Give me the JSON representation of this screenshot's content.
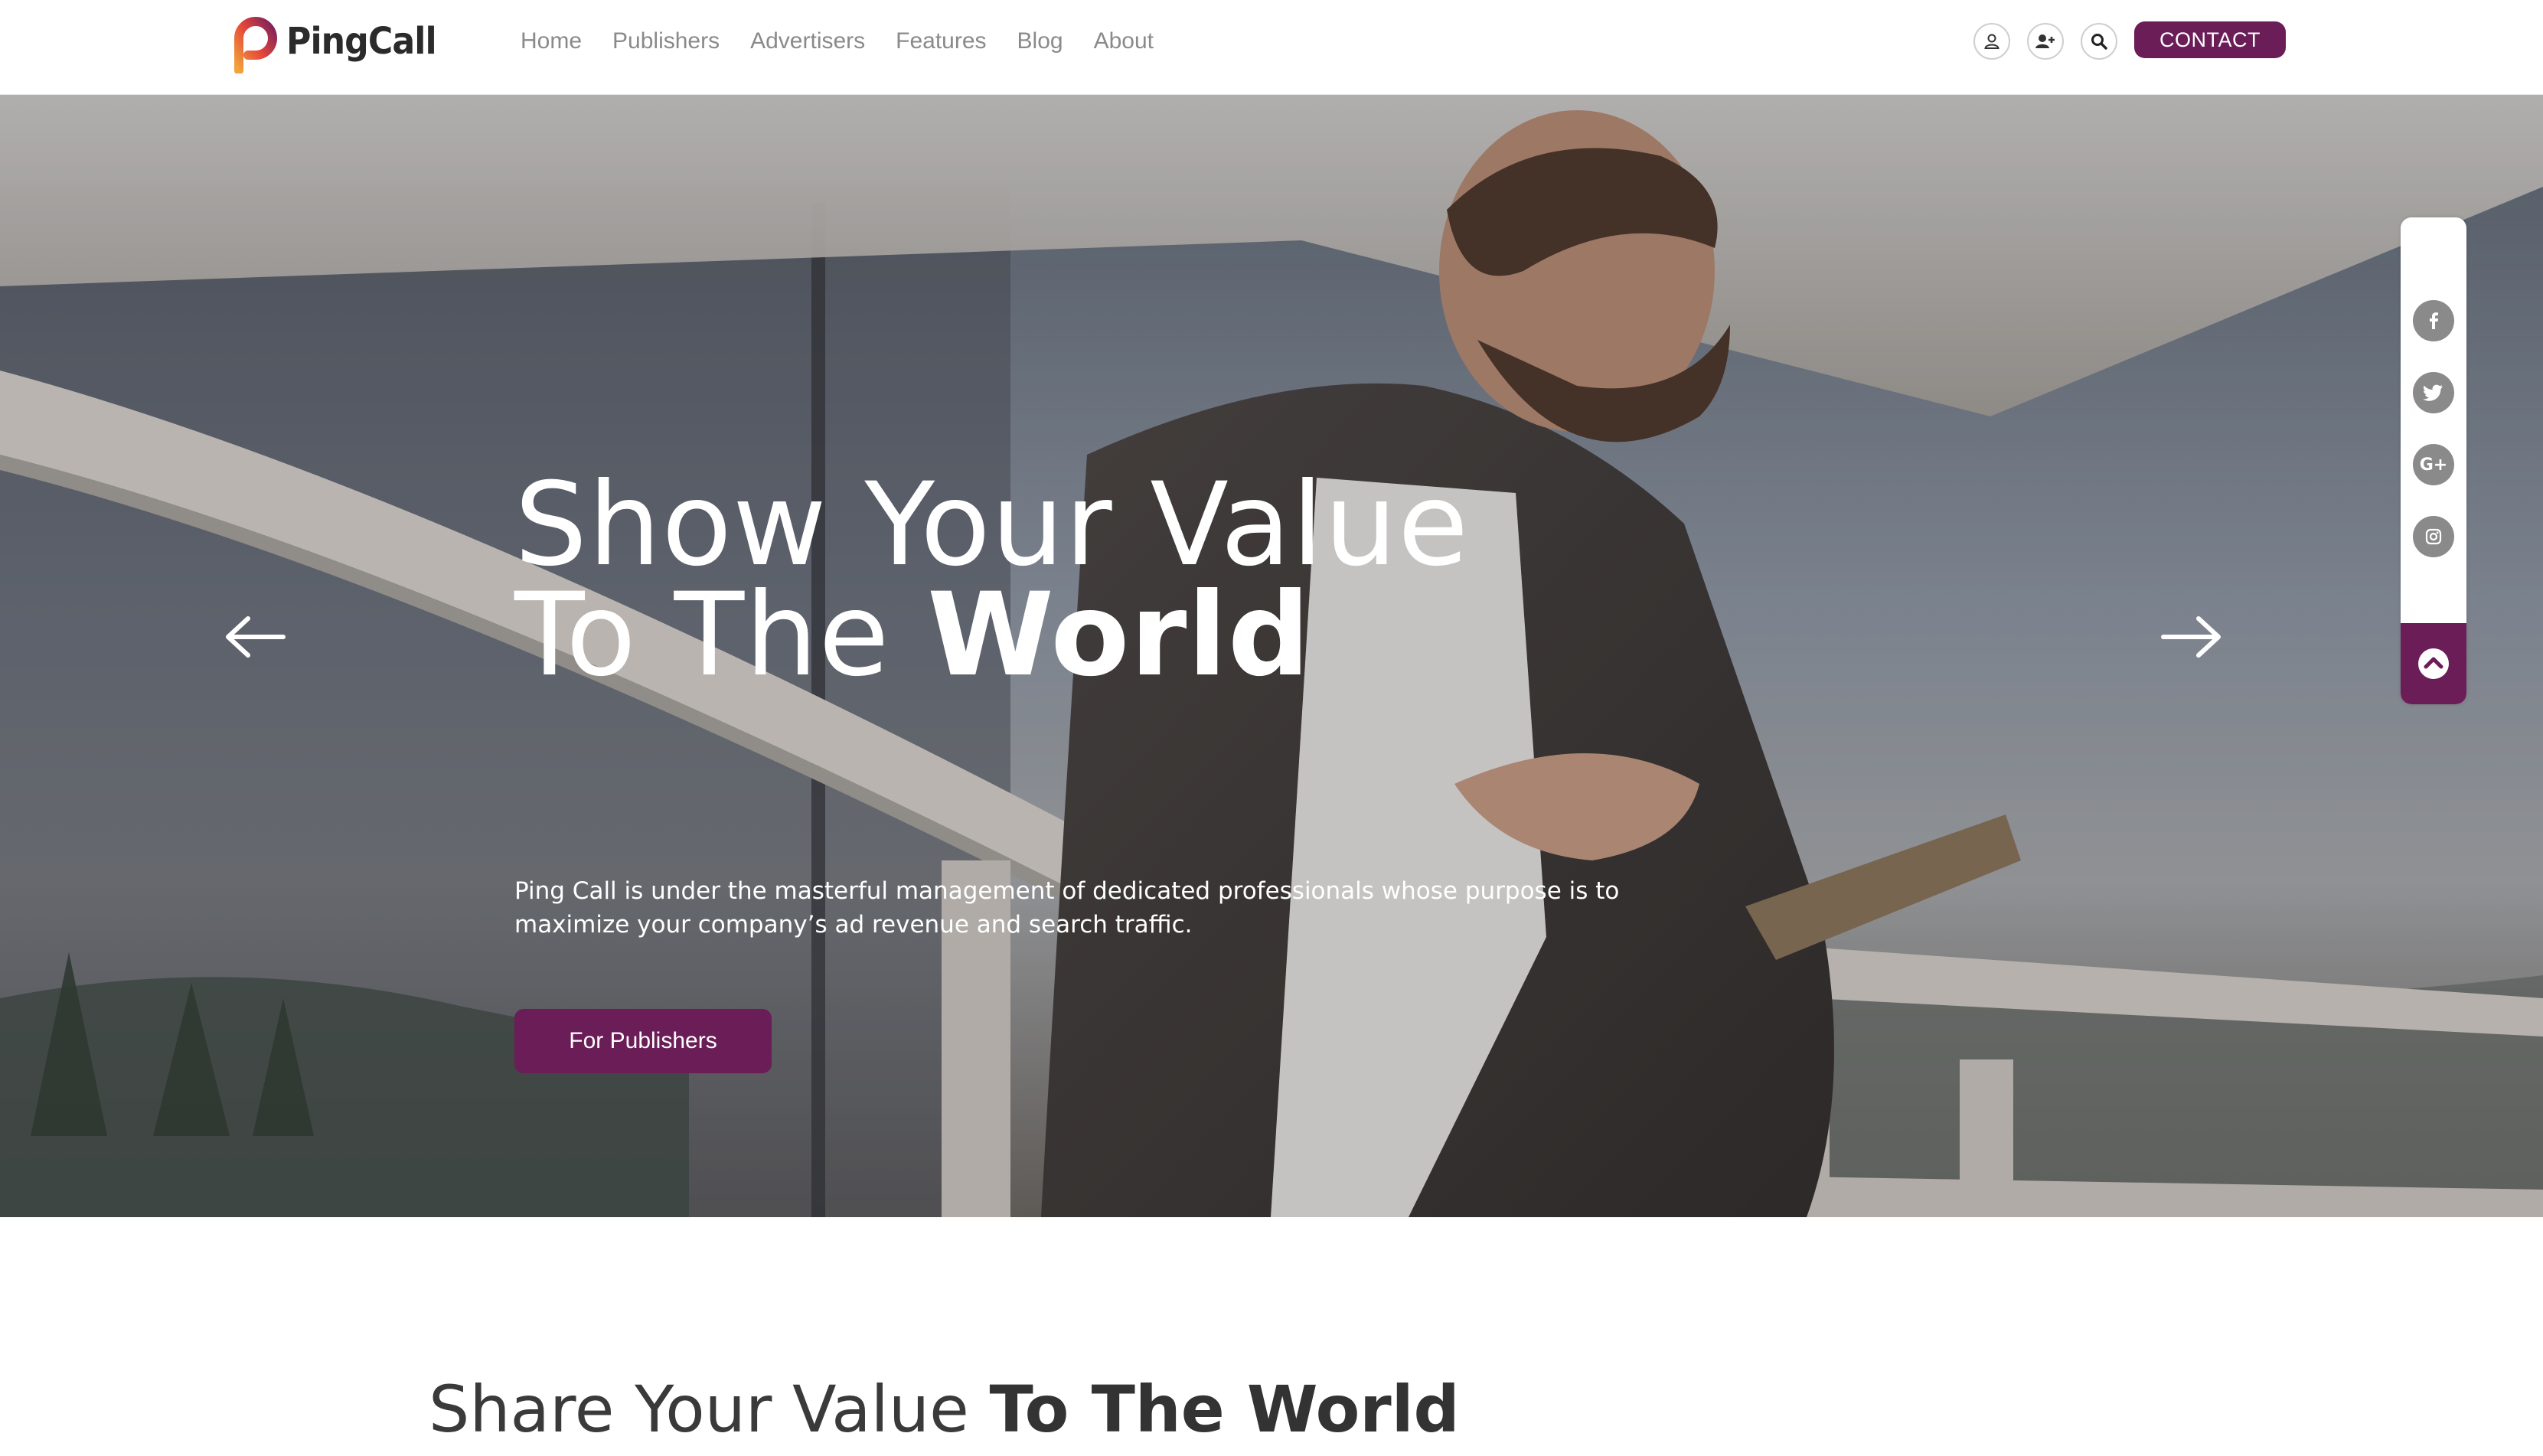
{
  "brand": {
    "name": "PingCall",
    "accent_color": "#6b1d57"
  },
  "nav": {
    "items": [
      {
        "label": "Home"
      },
      {
        "label": "Publishers"
      },
      {
        "label": "Advertisers"
      },
      {
        "label": "Features"
      },
      {
        "label": "Blog"
      },
      {
        "label": "About"
      }
    ]
  },
  "header_actions": {
    "icons": [
      "user-icon",
      "add-user-icon",
      "search-icon"
    ],
    "contact_label": "CONTACT"
  },
  "hero": {
    "title_line1": "Show Your Value",
    "title_line2_regular": "To The ",
    "title_line2_bold": "World",
    "description": "Ping Call is under the masterful management of dedicated professionals whose purpose is to maximize your company’s ad revenue and search traffic.",
    "cta_label": "For Publishers",
    "prev_icon": "arrow-left-icon",
    "next_icon": "arrow-right-icon"
  },
  "social": {
    "icons": [
      "facebook-icon",
      "twitter-icon",
      "google-plus-icon",
      "instagram-icon"
    ],
    "scroll_top_icon": "chevron-up-icon"
  },
  "section": {
    "title_regular": "Share Your Value ",
    "title_bold": "To The World"
  }
}
